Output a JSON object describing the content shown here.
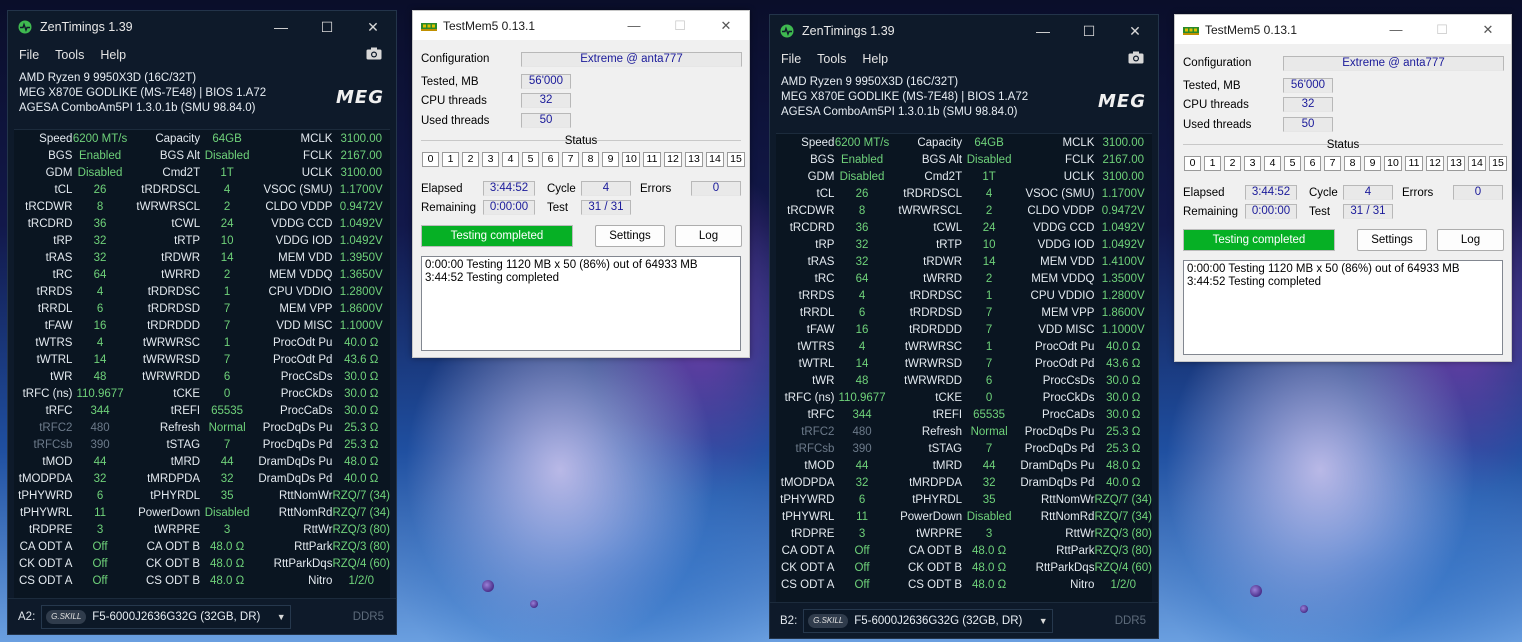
{
  "colors": {
    "zen_background": "#0e1a2a",
    "zen_value_green": "#6fd27a",
    "zen_dim_grey": "#6c7a8a",
    "testmem_progress_green": "#06b025",
    "testmem_field_text": "#1a1a9a"
  },
  "icons": {
    "zen_app": "pulse-icon",
    "camera": "camera-icon",
    "testmem_app": "memory-stick-icon",
    "dropdown": "chevron-down-icon"
  },
  "zen": [
    {
      "title": "ZenTimings 1.39",
      "menu": [
        "File",
        "Tools",
        "Help"
      ],
      "system": {
        "cpu": "AMD Ryzen 9 9950X3D (16C/32T)",
        "board": "MEG X870E GODLIKE (MS-7E48) | BIOS 1.A72",
        "agesa": "AGESA ComboAm5PI 1.3.0.1b (SMU 98.84.0)",
        "logo": "MEG"
      },
      "rows": [
        [
          [
            "Speed",
            "6200 MT/s"
          ],
          [
            "Capacity",
            "64GB"
          ],
          [
            "MCLK",
            "3100.00"
          ]
        ],
        [
          [
            "BGS",
            "Enabled"
          ],
          [
            "BGS Alt",
            "Disabled"
          ],
          [
            "FCLK",
            "2167.00"
          ]
        ],
        [
          [
            "GDM",
            "Disabled"
          ],
          [
            "Cmd2T",
            "1T"
          ],
          [
            "UCLK",
            "3100.00"
          ]
        ],
        [
          [
            "tCL",
            "26"
          ],
          [
            "tRDRDSCL",
            "4"
          ],
          [
            "VSOC (SMU)",
            "1.1700V"
          ]
        ],
        [
          [
            "tRCDWR",
            "8"
          ],
          [
            "tWRWRSCL",
            "2"
          ],
          [
            "CLDO VDDP",
            "0.9472V"
          ]
        ],
        [
          [
            "tRCDRD",
            "36"
          ],
          [
            "tCWL",
            "24"
          ],
          [
            "VDDG CCD",
            "1.0492V"
          ]
        ],
        [
          [
            "tRP",
            "32"
          ],
          [
            "tRTP",
            "10"
          ],
          [
            "VDDG IOD",
            "1.0492V"
          ]
        ],
        [
          [
            "tRAS",
            "32"
          ],
          [
            "tRDWR",
            "14"
          ],
          [
            "MEM VDD",
            "1.3950V"
          ]
        ],
        [
          [
            "tRC",
            "64"
          ],
          [
            "tWRRD",
            "2"
          ],
          [
            "MEM VDDQ",
            "1.3650V"
          ]
        ],
        [
          [
            "tRRDS",
            "4"
          ],
          [
            "tRDRDSC",
            "1"
          ],
          [
            "CPU VDDIO",
            "1.2800V"
          ]
        ],
        [
          [
            "tRRDL",
            "6"
          ],
          [
            "tRDRDSD",
            "7"
          ],
          [
            "MEM VPP",
            "1.8600V"
          ]
        ],
        [
          [
            "tFAW",
            "16"
          ],
          [
            "tRDRDDD",
            "7"
          ],
          [
            "VDD MISC",
            "1.1000V"
          ]
        ],
        [
          [
            "tWTRS",
            "4"
          ],
          [
            "tWRWRSC",
            "1"
          ],
          [
            "ProcOdt Pu",
            "40.0 Ω"
          ]
        ],
        [
          [
            "tWTRL",
            "14"
          ],
          [
            "tWRWRSD",
            "7"
          ],
          [
            "ProcOdt Pd",
            "43.6 Ω"
          ]
        ],
        [
          [
            "tWR",
            "48"
          ],
          [
            "tWRWRDD",
            "6"
          ],
          [
            "ProcCsDs",
            "30.0 Ω"
          ]
        ],
        [
          [
            "tRFC (ns)",
            "110.9677"
          ],
          [
            "tCKE",
            "0"
          ],
          [
            "ProcCkDs",
            "30.0 Ω"
          ]
        ],
        [
          [
            "tRFC",
            "344"
          ],
          [
            "tREFI",
            "65535"
          ],
          [
            "ProcCaDs",
            "30.0 Ω"
          ]
        ],
        [
          [
            "tRFC2",
            "480"
          ],
          [
            "Refresh",
            "Normal"
          ],
          [
            "ProcDqDs Pu",
            "25.3 Ω"
          ]
        ],
        [
          [
            "tRFCsb",
            "390"
          ],
          [
            "tSTAG",
            "7"
          ],
          [
            "ProcDqDs Pd",
            "25.3 Ω"
          ]
        ],
        [
          [
            "tMOD",
            "44"
          ],
          [
            "tMRD",
            "44"
          ],
          [
            "DramDqDs Pu",
            "48.0 Ω"
          ]
        ],
        [
          [
            "tMODPDA",
            "32"
          ],
          [
            "tMRDPDA",
            "32"
          ],
          [
            "DramDqDs Pd",
            "40.0 Ω"
          ]
        ],
        [
          [
            "tPHYWRD",
            "6"
          ],
          [
            "tPHYRDL",
            "35"
          ],
          [
            "RttNomWr",
            "RZQ/7 (34)"
          ]
        ],
        [
          [
            "tPHYWRL",
            "11"
          ],
          [
            "PowerDown",
            "Disabled"
          ],
          [
            "RttNomRd",
            "RZQ/7 (34)"
          ]
        ],
        [
          [
            "tRDPRE",
            "3"
          ],
          [
            "tWRPRE",
            "3"
          ],
          [
            "RttWr",
            "RZQ/3 (80)"
          ]
        ],
        [
          [
            "CA ODT A",
            "Off"
          ],
          [
            "CA ODT B",
            "48.0 Ω"
          ],
          [
            "RttPark",
            "RZQ/3 (80)"
          ]
        ],
        [
          [
            "CK ODT A",
            "Off"
          ],
          [
            "CK ODT B",
            "48.0 Ω"
          ],
          [
            "RttParkDqs",
            "RZQ/4 (60)"
          ]
        ],
        [
          [
            "CS ODT A",
            "Off"
          ],
          [
            "CS ODT B",
            "48.0 Ω"
          ],
          [
            "Nitro",
            "1/2/0"
          ]
        ]
      ],
      "slot": "A2:",
      "dimm_brand": "G.SKILL",
      "dimm": "F5-6000J2636G32G (32GB, DR)",
      "ddr": "DDR5"
    },
    {
      "title": "ZenTimings 1.39",
      "menu": [
        "File",
        "Tools",
        "Help"
      ],
      "system": {
        "cpu": "AMD Ryzen 9 9950X3D (16C/32T)",
        "board": "MEG X870E GODLIKE (MS-7E48) | BIOS 1.A72",
        "agesa": "AGESA ComboAm5PI 1.3.0.1b (SMU 98.84.0)",
        "logo": "MEG"
      },
      "rows": [
        [
          [
            "Speed",
            "6200 MT/s"
          ],
          [
            "Capacity",
            "64GB"
          ],
          [
            "MCLK",
            "3100.00"
          ]
        ],
        [
          [
            "BGS",
            "Enabled"
          ],
          [
            "BGS Alt",
            "Disabled"
          ],
          [
            "FCLK",
            "2167.00"
          ]
        ],
        [
          [
            "GDM",
            "Disabled"
          ],
          [
            "Cmd2T",
            "1T"
          ],
          [
            "UCLK",
            "3100.00"
          ]
        ],
        [
          [
            "tCL",
            "26"
          ],
          [
            "tRDRDSCL",
            "4"
          ],
          [
            "VSOC (SMU)",
            "1.1700V"
          ]
        ],
        [
          [
            "tRCDWR",
            "8"
          ],
          [
            "tWRWRSCL",
            "2"
          ],
          [
            "CLDO VDDP",
            "0.9472V"
          ]
        ],
        [
          [
            "tRCDRD",
            "36"
          ],
          [
            "tCWL",
            "24"
          ],
          [
            "VDDG CCD",
            "1.0492V"
          ]
        ],
        [
          [
            "tRP",
            "32"
          ],
          [
            "tRTP",
            "10"
          ],
          [
            "VDDG IOD",
            "1.0492V"
          ]
        ],
        [
          [
            "tRAS",
            "32"
          ],
          [
            "tRDWR",
            "14"
          ],
          [
            "MEM VDD",
            "1.4100V"
          ]
        ],
        [
          [
            "tRC",
            "64"
          ],
          [
            "tWRRD",
            "2"
          ],
          [
            "MEM VDDQ",
            "1.3500V"
          ]
        ],
        [
          [
            "tRRDS",
            "4"
          ],
          [
            "tRDRDSC",
            "1"
          ],
          [
            "CPU VDDIO",
            "1.2800V"
          ]
        ],
        [
          [
            "tRRDL",
            "6"
          ],
          [
            "tRDRDSD",
            "7"
          ],
          [
            "MEM VPP",
            "1.8600V"
          ]
        ],
        [
          [
            "tFAW",
            "16"
          ],
          [
            "tRDRDDD",
            "7"
          ],
          [
            "VDD MISC",
            "1.1000V"
          ]
        ],
        [
          [
            "tWTRS",
            "4"
          ],
          [
            "tWRWRSC",
            "1"
          ],
          [
            "ProcOdt Pu",
            "40.0 Ω"
          ]
        ],
        [
          [
            "tWTRL",
            "14"
          ],
          [
            "tWRWRSD",
            "7"
          ],
          [
            "ProcOdt Pd",
            "43.6 Ω"
          ]
        ],
        [
          [
            "tWR",
            "48"
          ],
          [
            "tWRWRDD",
            "6"
          ],
          [
            "ProcCsDs",
            "30.0 Ω"
          ]
        ],
        [
          [
            "tRFC (ns)",
            "110.9677"
          ],
          [
            "tCKE",
            "0"
          ],
          [
            "ProcCkDs",
            "30.0 Ω"
          ]
        ],
        [
          [
            "tRFC",
            "344"
          ],
          [
            "tREFI",
            "65535"
          ],
          [
            "ProcCaDs",
            "30.0 Ω"
          ]
        ],
        [
          [
            "tRFC2",
            "480"
          ],
          [
            "Refresh",
            "Normal"
          ],
          [
            "ProcDqDs Pu",
            "25.3 Ω"
          ]
        ],
        [
          [
            "tRFCsb",
            "390"
          ],
          [
            "tSTAG",
            "7"
          ],
          [
            "ProcDqDs Pd",
            "25.3 Ω"
          ]
        ],
        [
          [
            "tMOD",
            "44"
          ],
          [
            "tMRD",
            "44"
          ],
          [
            "DramDqDs Pu",
            "48.0 Ω"
          ]
        ],
        [
          [
            "tMODPDA",
            "32"
          ],
          [
            "tMRDPDA",
            "32"
          ],
          [
            "DramDqDs Pd",
            "40.0 Ω"
          ]
        ],
        [
          [
            "tPHYWRD",
            "6"
          ],
          [
            "tPHYRDL",
            "35"
          ],
          [
            "RttNomWr",
            "RZQ/7 (34)"
          ]
        ],
        [
          [
            "tPHYWRL",
            "11"
          ],
          [
            "PowerDown",
            "Disabled"
          ],
          [
            "RttNomRd",
            "RZQ/7 (34)"
          ]
        ],
        [
          [
            "tRDPRE",
            "3"
          ],
          [
            "tWRPRE",
            "3"
          ],
          [
            "RttWr",
            "RZQ/3 (80)"
          ]
        ],
        [
          [
            "CA ODT A",
            "Off"
          ],
          [
            "CA ODT B",
            "48.0 Ω"
          ],
          [
            "RttPark",
            "RZQ/3 (80)"
          ]
        ],
        [
          [
            "CK ODT A",
            "Off"
          ],
          [
            "CK ODT B",
            "48.0 Ω"
          ],
          [
            "RttParkDqs",
            "RZQ/4 (60)"
          ]
        ],
        [
          [
            "CS ODT A",
            "Off"
          ],
          [
            "CS ODT B",
            "48.0 Ω"
          ],
          [
            "Nitro",
            "1/2/0"
          ]
        ]
      ],
      "slot": "B2:",
      "dimm_brand": "G.SKILL",
      "dimm": "F5-6000J2636G32G (32GB, DR)",
      "ddr": "DDR5"
    }
  ],
  "testmem": [
    {
      "title": "TestMem5  0.13.1",
      "configuration_label": "Configuration",
      "configuration_value": "Extreme @ anta777",
      "tested_label": "Tested, MB",
      "tested_value": "56'000",
      "cpu_threads_label": "CPU threads",
      "cpu_threads_value": "32",
      "used_threads_label": "Used threads",
      "used_threads_value": "50",
      "status_label": "Status",
      "threads": [
        "0",
        "1",
        "2",
        "3",
        "4",
        "5",
        "6",
        "7",
        "8",
        "9",
        "10",
        "11",
        "12",
        "13",
        "14",
        "15"
      ],
      "elapsed_label": "Elapsed",
      "elapsed_value": "3:44:52",
      "cycle_label": "Cycle",
      "cycle_value": "4",
      "errors_label": "Errors",
      "errors_value": "0",
      "remaining_label": "Remaining",
      "remaining_value": "0:00:00",
      "test_label": "Test",
      "test_value": "31 / 31",
      "progress_text": "Testing completed",
      "progress_fraction": 1.0,
      "settings_label": "Settings",
      "log_button_label": "Log",
      "log_lines": [
        "0:00:00  Testing 1120 MB x 50 (86%) out of 64933 MB",
        "3:44:52  Testing completed"
      ]
    },
    {
      "title": "TestMem5  0.13.1",
      "configuration_label": "Configuration",
      "configuration_value": "Extreme @ anta777",
      "tested_label": "Tested, MB",
      "tested_value": "56'000",
      "cpu_threads_label": "CPU threads",
      "cpu_threads_value": "32",
      "used_threads_label": "Used threads",
      "used_threads_value": "50",
      "status_label": "Status",
      "threads": [
        "0",
        "1",
        "2",
        "3",
        "4",
        "5",
        "6",
        "7",
        "8",
        "9",
        "10",
        "11",
        "12",
        "13",
        "14",
        "15"
      ],
      "elapsed_label": "Elapsed",
      "elapsed_value": "3:44:52",
      "cycle_label": "Cycle",
      "cycle_value": "4",
      "errors_label": "Errors",
      "errors_value": "0",
      "remaining_label": "Remaining",
      "remaining_value": "0:00:00",
      "test_label": "Test",
      "test_value": "31 / 31",
      "progress_text": "Testing completed",
      "progress_fraction": 1.0,
      "settings_label": "Settings",
      "log_button_label": "Log",
      "log_lines": [
        "0:00:00  Testing 1120 MB x 50 (86%) out of 64933 MB",
        "3:44:52  Testing completed"
      ]
    }
  ]
}
